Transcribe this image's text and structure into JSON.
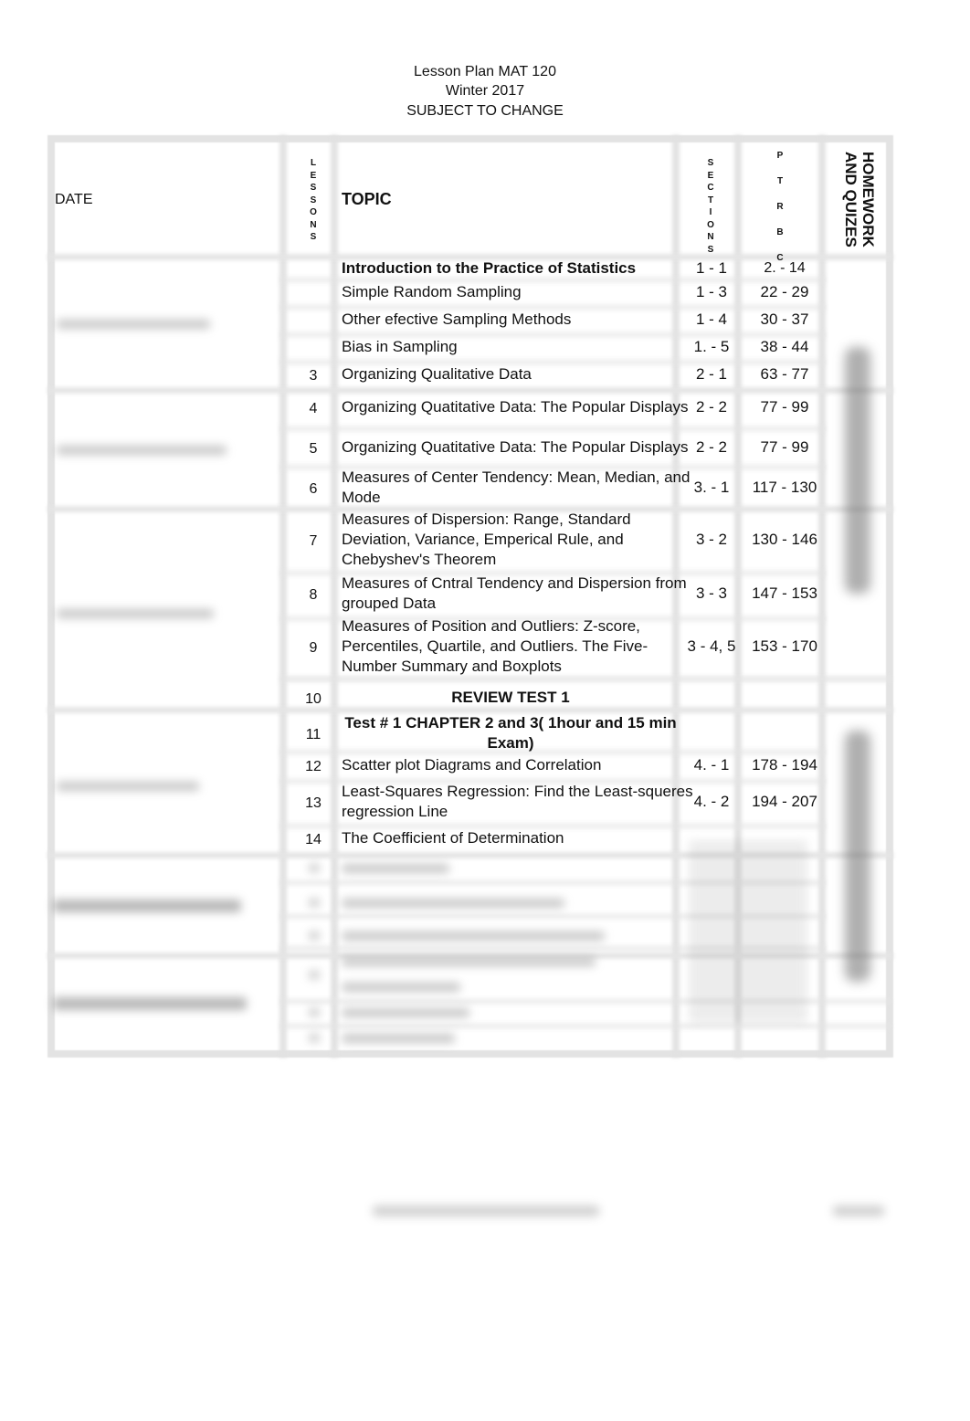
{
  "document": {
    "title": "Lesson Plan MAT 120",
    "term": "Winter 2017",
    "notice": "SUBJECT TO CHANGE"
  },
  "table": {
    "headers": {
      "date": "DATE",
      "lessons": [
        "L",
        "E",
        "S",
        "S",
        "O",
        "N",
        "S"
      ],
      "topic": "TOPIC",
      "sections": [
        "S",
        "E",
        "C",
        "T",
        "I",
        "O",
        "N",
        "S"
      ],
      "ptrbc": [
        "P",
        "T",
        "R",
        "B",
        "C"
      ],
      "homework": "HOMEWORK AND QUIZES"
    },
    "rows": [
      {
        "lesson": "",
        "topic": "Introduction to the Practice of Statistics",
        "bold": true,
        "section": "1 - 1",
        "pages": "2. - 14"
      },
      {
        "lesson": "",
        "topic": "Simple Random Sampling",
        "section": "1 - 3",
        "pages": "22 - 29"
      },
      {
        "lesson": "",
        "topic": "Other efective Sampling Methods",
        "section": "1 - 4",
        "pages": "30 - 37"
      },
      {
        "lesson": "",
        "topic": "Bias in Sampling",
        "section": "1. - 5",
        "pages": "38 - 44"
      },
      {
        "lesson": "3",
        "topic": "Organizing Qualitative Data",
        "section": "2 - 1",
        "pages": "63 - 77"
      },
      {
        "lesson": "4",
        "topic": "Organizing Quatitative Data: The Popular Displays",
        "section": "2 - 2",
        "pages": "77 - 99"
      },
      {
        "lesson": "5",
        "topic": "Organizing Quatitative Data: The Popular Displays",
        "section": "2 - 2",
        "pages": "77 - 99"
      },
      {
        "lesson": "6",
        "topic_lines": [
          "Measures of Center Tendency: Mean, Median, and",
          "Mode"
        ],
        "section": "3. - 1",
        "pages": "117 - 130"
      },
      {
        "lesson": "7",
        "topic_lines": [
          "Measures of Dispersion: Range, Standard",
          "Deviation, Variance, Emperical Rule, and",
          "Chebyshev's Theorem"
        ],
        "section": "3 - 2",
        "pages": "130 - 146"
      },
      {
        "lesson": "8",
        "topic_lines": [
          "Measures of Cntral Tendency and Dispersion from",
          "grouped Data"
        ],
        "section": "3 - 3",
        "pages": "147 - 153"
      },
      {
        "lesson": "9",
        "topic_lines": [
          "Measures of Position and Outliers: Z-score,",
          "Percentiles, Quartile, and Outliers. The Five-",
          "Number Summary and Boxplots"
        ],
        "section": "3 - 4, 5",
        "pages": "153 - 170"
      },
      {
        "lesson": "10",
        "topic": "REVIEW TEST 1",
        "bold": true,
        "centered": true,
        "section": "",
        "pages": ""
      },
      {
        "lesson": "11",
        "topic_lines": [
          "Test # 1 CHAPTER 2 and 3( 1hour and 15 min",
          "Exam)"
        ],
        "bold": true,
        "centered": true,
        "section": "",
        "pages": ""
      },
      {
        "lesson": "12",
        "topic": "Scatter plot Diagrams and Correlation",
        "section": "4. - 1",
        "pages": "178 - 194"
      },
      {
        "lesson": "13",
        "topic_lines": [
          "Least-Squares Regression: Find the Least-squeres",
          "regression Line"
        ],
        "section": "4. - 2",
        "pages": "194 - 207"
      },
      {
        "lesson": "14",
        "topic": "The Coefficient of Determination",
        "section": "",
        "pages": ""
      }
    ]
  }
}
